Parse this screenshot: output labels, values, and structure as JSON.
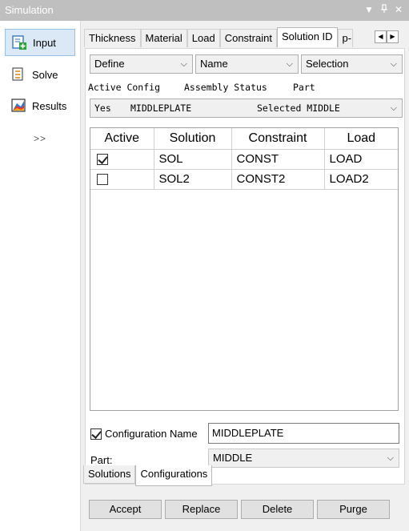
{
  "window": {
    "title": "Simulation",
    "controls": [
      "▾",
      "ᵖ",
      "×"
    ]
  },
  "sidebar": {
    "items": [
      {
        "label": "Input",
        "icon": "input-icon",
        "active": true
      },
      {
        "label": "Solve",
        "icon": "solve-icon",
        "active": false
      },
      {
        "label": "Results",
        "icon": "results-icon",
        "active": false
      }
    ],
    "more_label": ">>"
  },
  "tabs": {
    "items": [
      "Thickness",
      "Material",
      "Load",
      "Constraint",
      "Solution ID",
      "p-"
    ],
    "active": "Solution ID"
  },
  "filters": {
    "define": "Define",
    "name": "Name",
    "selection": "Selection"
  },
  "config_header": {
    "active_config": "Active Config",
    "assembly_status": "Assembly Status",
    "part": "Part"
  },
  "config_row": {
    "active": "Yes",
    "name": "MIDDLEPLATE",
    "status": "Selected MIDDLE"
  },
  "grid": {
    "columns": [
      "Active",
      "Solution",
      "Constraint",
      "Load"
    ],
    "rows": [
      {
        "active": true,
        "solution": "SOL",
        "constraint": "CONST",
        "load": "LOAD"
      },
      {
        "active": false,
        "solution": "SOL2",
        "constraint": "CONST2",
        "load": "LOAD2"
      }
    ]
  },
  "config_name": {
    "label": "Configuration Name",
    "checked": true,
    "value": "MIDDLEPLATE"
  },
  "part": {
    "label": "Part:",
    "value": "MIDDLE"
  },
  "bottom_tabs": {
    "items": [
      "Solutions",
      "Configurations"
    ],
    "active": "Configurations"
  },
  "buttons": {
    "accept": "Accept",
    "replace": "Replace",
    "delete": "Delete",
    "purge": "Purge"
  },
  "colors": {
    "titlebar": "#bfbfbf",
    "active_nav_bg": "#dbe9f6",
    "active_nav_border": "#99c2e6"
  }
}
